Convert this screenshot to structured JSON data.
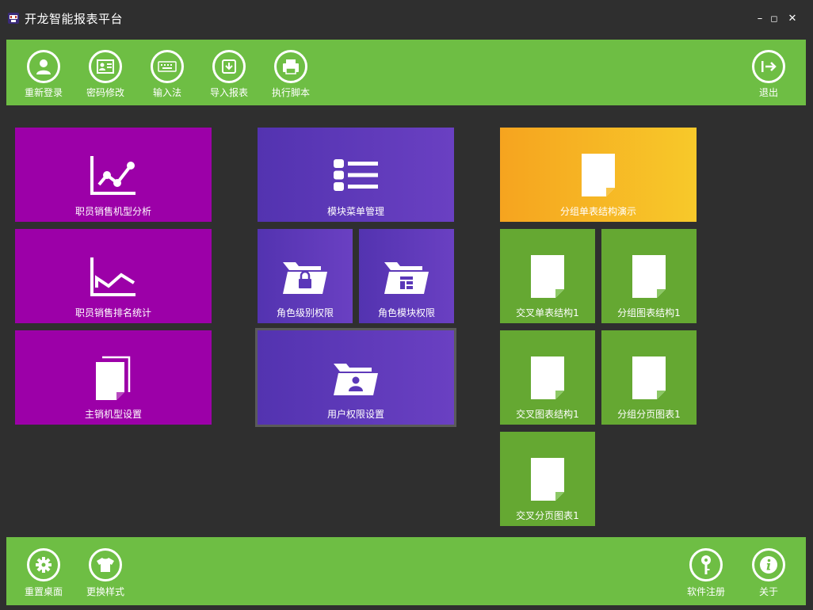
{
  "window": {
    "title": "开龙智能报表平台",
    "minimize_glyph": "–",
    "maximize_glyph": "◻",
    "close_glyph": "✕"
  },
  "toolbar_top": {
    "items": [
      {
        "label": "重新登录",
        "icon": "user-login-icon"
      },
      {
        "label": "密码修改",
        "icon": "id-card-icon"
      },
      {
        "label": "输入法",
        "icon": "keyboard-icon"
      },
      {
        "label": "导入报表",
        "icon": "import-icon"
      },
      {
        "label": "执行脚本",
        "icon": "script-printer-icon"
      }
    ],
    "exit": {
      "label": "退出",
      "icon": "exit-icon"
    }
  },
  "toolbar_bottom": {
    "left": [
      {
        "label": "重置桌面",
        "icon": "gear-icon"
      },
      {
        "label": "更换样式",
        "icon": "tshirt-icon"
      }
    ],
    "right": [
      {
        "label": "软件注册",
        "icon": "key-icon"
      },
      {
        "label": "关于",
        "icon": "info-icon"
      }
    ]
  },
  "tiles": {
    "sales_analysis": {
      "label": "职员销售机型分析",
      "icon": "line-chart-icon"
    },
    "sales_ranking": {
      "label": "职员销售排名统计",
      "icon": "area-chart-icon"
    },
    "main_model_settings": {
      "label": "主销机型设置",
      "icon": "document-stack-icon"
    },
    "module_menu": {
      "label": "模块菜单管理",
      "icon": "list-icon"
    },
    "role_level_perm": {
      "label": "角色级别权限",
      "icon": "folder-lock-icon"
    },
    "role_module_perm": {
      "label": "角色模块权限",
      "icon": "folder-layout-icon"
    },
    "user_perm": {
      "label": "用户权限设置",
      "icon": "folder-user-icon"
    },
    "group_table_demo": {
      "label": "分组单表结构演示",
      "icon": "document-icon"
    },
    "cross_table_1": {
      "label": "交叉单表结构1",
      "icon": "document-icon"
    },
    "group_chart_1": {
      "label": "分组图表结构1",
      "icon": "document-icon"
    },
    "cross_chart_1": {
      "label": "交叉图表结构1",
      "icon": "document-icon"
    },
    "group_paged_1": {
      "label": "分组分页图表1",
      "icon": "document-icon"
    },
    "cross_paged_1": {
      "label": "交叉分页图表1",
      "icon": "document-icon"
    }
  },
  "colors": {
    "toolbar": "#6ebe44",
    "purple": "#9c00a8",
    "indigo": "#5a38b8",
    "orange": "#f7b522",
    "green": "#65a832",
    "background": "#2f2f2f"
  }
}
